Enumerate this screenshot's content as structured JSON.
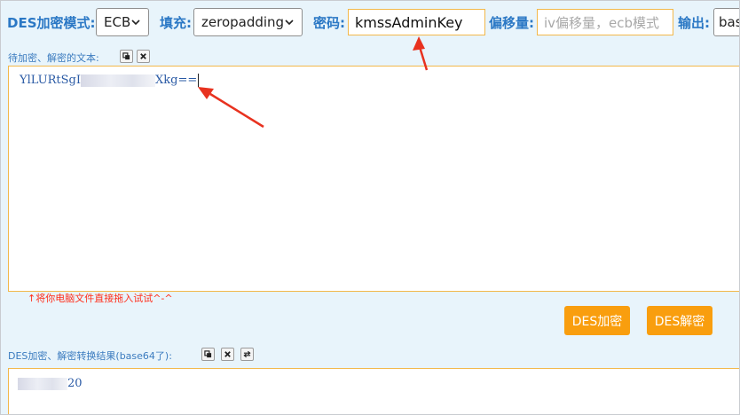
{
  "toolbar": {
    "mode_label": "DES加密模式:",
    "mode_value": "ECB",
    "padding_label": "填充:",
    "padding_value": "zeropadding",
    "key_label": "密码:",
    "key_value": "kmssAdminKey",
    "iv_label": "偏移量:",
    "iv_placeholder": "iv偏移量，ecb模式",
    "output_label": "输出:",
    "output_value": "bas"
  },
  "input_section": {
    "label": "待加密、解密的文本:",
    "text_prefix": "YlLURtSgI",
    "text_suffix": "Xkg=="
  },
  "hint": "↑将你电脑文件直接拖入试试^-^",
  "actions": {
    "encrypt": "DES加密",
    "decrypt": "DES解密"
  },
  "result_section": {
    "label": "DES加密、解密转换结果(base64了):",
    "text_suffix": "20"
  },
  "colors": {
    "label_blue": "#2b78c5",
    "button_orange": "#f99e0e",
    "input_border": "#f2b84b",
    "annotation_red": "#e8321f",
    "background": "#e8f4fb"
  },
  "icons": [
    "chevron-down-icon",
    "copy-icon",
    "clear-icon",
    "swap-icon",
    "red-arrow-annotation"
  ]
}
